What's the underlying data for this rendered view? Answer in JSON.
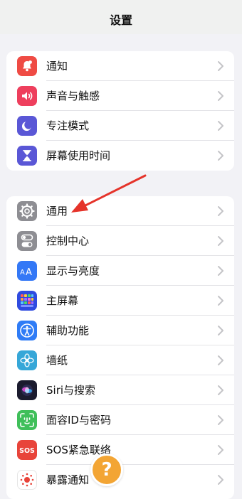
{
  "header": {
    "title": "设置"
  },
  "groups": [
    {
      "items": [
        {
          "label": "通知",
          "icon": "bell-icon",
          "color": "#ef4b44"
        },
        {
          "label": "声音与触感",
          "icon": "speaker-icon",
          "color": "#ee3f5d"
        },
        {
          "label": "专注模式",
          "icon": "moon-icon",
          "color": "#5a57d6"
        },
        {
          "label": "屏幕使用时间",
          "icon": "hourglass-icon",
          "color": "#5a57d6"
        }
      ]
    },
    {
      "items": [
        {
          "label": "通用",
          "icon": "gear-icon",
          "color": "#8e8e93"
        },
        {
          "label": "控制中心",
          "icon": "toggles-icon",
          "color": "#8e8e93"
        },
        {
          "label": "显示与亮度",
          "icon": "text-size-icon",
          "color": "#3478f6"
        },
        {
          "label": "主屏幕",
          "icon": "app-grid-icon",
          "color": "#2f4be0"
        },
        {
          "label": "辅助功能",
          "icon": "accessibility-icon",
          "color": "#2f7cf6"
        },
        {
          "label": "墙纸",
          "icon": "flower-icon",
          "color": "#36a7d8"
        },
        {
          "label": "Siri与搜索",
          "icon": "siri-icon",
          "color": "#1b1b2e"
        },
        {
          "label": "面容ID与密码",
          "icon": "face-id-icon",
          "color": "#3fbf5a"
        },
        {
          "label": "SOS紧急联络",
          "icon": "sos-icon",
          "color": "#e8443a"
        },
        {
          "label": "暴露通知",
          "icon": "exposure-icon",
          "color": "#ffffff"
        }
      ]
    }
  ],
  "overlay": {
    "help_text": "?"
  },
  "colors": {
    "annotation_arrow": "#e5332a",
    "help_badge": "#f3a534"
  }
}
